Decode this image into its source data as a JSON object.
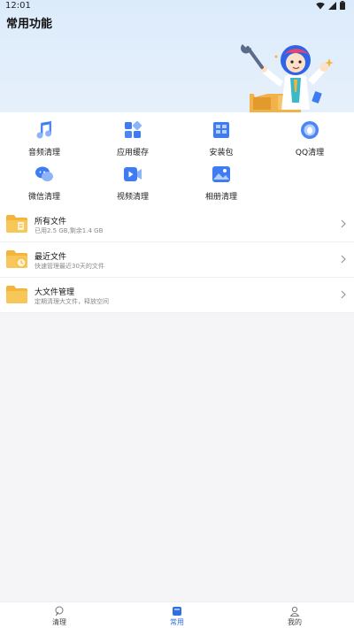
{
  "status": {
    "time": "12:01"
  },
  "header": {
    "title": "常用功能"
  },
  "tools": [
    {
      "label": "音频清理",
      "icon": "music-note-icon"
    },
    {
      "label": "应用缓存",
      "icon": "app-grid-icon"
    },
    {
      "label": "安装包",
      "icon": "package-icon"
    },
    {
      "label": "QQ清理",
      "icon": "qq-penguin-icon"
    },
    {
      "label": "微信清理",
      "icon": "wechat-icon"
    },
    {
      "label": "视频清理",
      "icon": "video-play-icon"
    },
    {
      "label": "相册清理",
      "icon": "photo-icon"
    }
  ],
  "files": [
    {
      "title": "所有文件",
      "subtitle": "已用2.5 GB,剩余1.4 GB",
      "icon": "folder-storage-icon"
    },
    {
      "title": "最近文件",
      "subtitle": "快速管理最近30天的文件",
      "icon": "folder-clock-icon"
    },
    {
      "title": "大文件管理",
      "subtitle": "定期清理大文件，释放空间",
      "icon": "folder-icon"
    }
  ],
  "tabs": [
    {
      "label": "清理",
      "icon": "broom-icon",
      "active": false
    },
    {
      "label": "常用",
      "icon": "grid-square-icon",
      "active": true
    },
    {
      "label": "我的",
      "icon": "person-icon",
      "active": false
    }
  ],
  "colors": {
    "accent": "#2f6fe0",
    "header_bg": "#dcebfb",
    "folder": "#f5b43a"
  }
}
